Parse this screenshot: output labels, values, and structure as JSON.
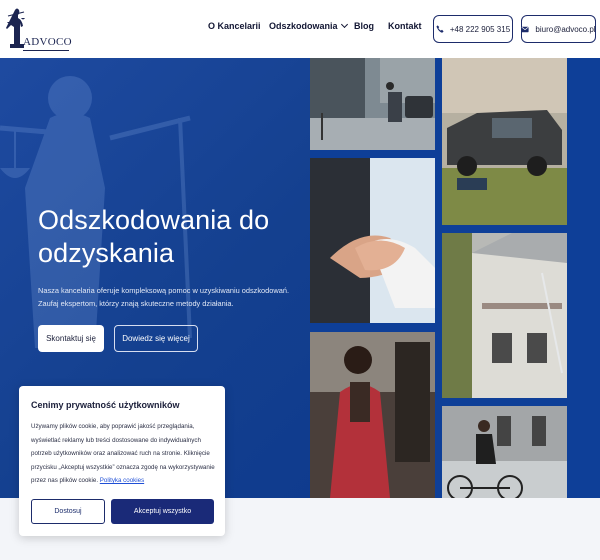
{
  "brand": {
    "logo_text": "ADVOCO"
  },
  "nav": {
    "items": [
      {
        "label": "O Kancelarii"
      },
      {
        "label": "Odszkodowania"
      },
      {
        "label": "Blog"
      },
      {
        "label": "Kontakt"
      }
    ],
    "phone": "+48 222 905 315",
    "email": "biuro@advoco.pl"
  },
  "hero": {
    "title": "Odszkodowania do odzyskania",
    "description": "Nasza kancelaria oferuje kompleksową pomoc w uzyskiwaniu odszkodowań. Zaufaj ekspertom, którzy znają skuteczne metody działania.",
    "primary_button": "Skontaktuj się",
    "secondary_button": "Dowiedz się więcej"
  },
  "cookie": {
    "title": "Cenimy prywatność użytkowników",
    "text": "Używamy plików cookie, aby poprawić jakość przeglądania, wyświetlać reklamy lub treści dostosowane do indywidualnych potrzeb użytkowników oraz analizować ruch na stronie. Kliknięcie przycisku „Akceptuj wszystkie” oznacza zgodę na wykorzystywanie przez nas plików cookie.",
    "link": "Polityka cookies",
    "reject_button": "Dostosuj",
    "accept_button": "Akceptuj wszystko"
  },
  "colors": {
    "hero_blue": "#0e3f98",
    "accent_navy": "#1a2a78",
    "link_blue": "#1f4fd6"
  }
}
